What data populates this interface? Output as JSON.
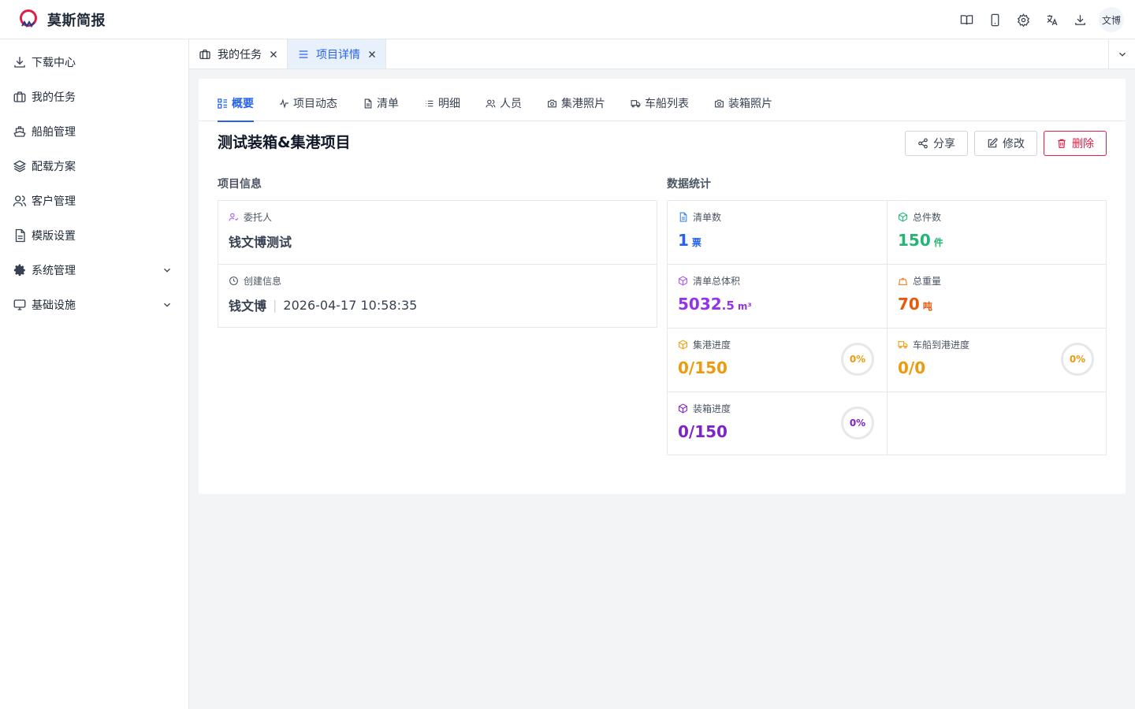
{
  "app": {
    "title": "莫斯简报",
    "logo_icon": "logo-icon"
  },
  "header": {
    "icons": [
      "book-icon",
      "tablet-icon",
      "gear-icon",
      "translate-icon",
      "download-icon"
    ],
    "avatar": "文博"
  },
  "sidebar": {
    "items": [
      {
        "label": "下载中心",
        "icon": "download-icon"
      },
      {
        "label": "我的任务",
        "icon": "briefcase-icon"
      },
      {
        "label": "船舶管理",
        "icon": "ship-icon"
      },
      {
        "label": "配载方案",
        "icon": "layers-icon"
      },
      {
        "label": "客户管理",
        "icon": "users-icon"
      },
      {
        "label": "模版设置",
        "icon": "document-icon"
      },
      {
        "label": "系统管理",
        "icon": "gear-icon",
        "expandable": true
      },
      {
        "label": "基础设施",
        "icon": "monitor-icon",
        "expandable": true
      }
    ]
  },
  "tabs": [
    {
      "label": "我的任务",
      "icon": "briefcase-icon",
      "active": false
    },
    {
      "label": "项目详情",
      "icon": "menu-icon",
      "active": true
    }
  ],
  "subtabs": [
    {
      "label": "概要",
      "icon": "dashboard-icon",
      "active": true
    },
    {
      "label": "项目动态",
      "icon": "activity-icon",
      "active": false
    },
    {
      "label": "清单",
      "icon": "document-icon",
      "active": false
    },
    {
      "label": "明细",
      "icon": "list-icon",
      "active": false
    },
    {
      "label": "人员",
      "icon": "users-icon",
      "active": false
    },
    {
      "label": "集港照片",
      "icon": "camera-icon",
      "active": false
    },
    {
      "label": "车船列表",
      "icon": "truck-icon",
      "active": false
    },
    {
      "label": "装箱照片",
      "icon": "camera-icon",
      "active": false
    }
  ],
  "project": {
    "title": "测试装箱&集港项目",
    "actions": {
      "share": "分享",
      "edit": "修改",
      "delete": "删除"
    }
  },
  "info": {
    "section_label": "项目信息",
    "client_label": "委托人",
    "client_value": "钱文博测试",
    "created_label": "创建信息",
    "created_by": "钱文博",
    "separator": "|",
    "created_at": "2026-04-17 10:58:35"
  },
  "stats": {
    "section_label": "数据统计",
    "manifest_count": {
      "label": "清单数",
      "value": "1",
      "unit": "票",
      "color": "#2563eb"
    },
    "total_pieces": {
      "label": "总件数",
      "value": "150",
      "unit": "件",
      "color": "#22b573"
    },
    "total_volume": {
      "label": "清单总体积",
      "value_int": "5032",
      "value_dec": ".5",
      "unit": "m³",
      "color": "#9333ea"
    },
    "total_weight": {
      "label": "总重量",
      "value": "70",
      "unit": "吨",
      "color": "#ea580c"
    },
    "port_progress": {
      "label": "集港进度",
      "value": "0/150",
      "percent": "0%",
      "color": "#f59e0b"
    },
    "vehicle_progress": {
      "label": "车船到港进度",
      "value": "0/0",
      "percent": "0%",
      "color": "#f59e0b"
    },
    "packing_progress": {
      "label": "装箱进度",
      "value": "0/150",
      "percent": "0%",
      "color": "#7e22ce"
    }
  }
}
